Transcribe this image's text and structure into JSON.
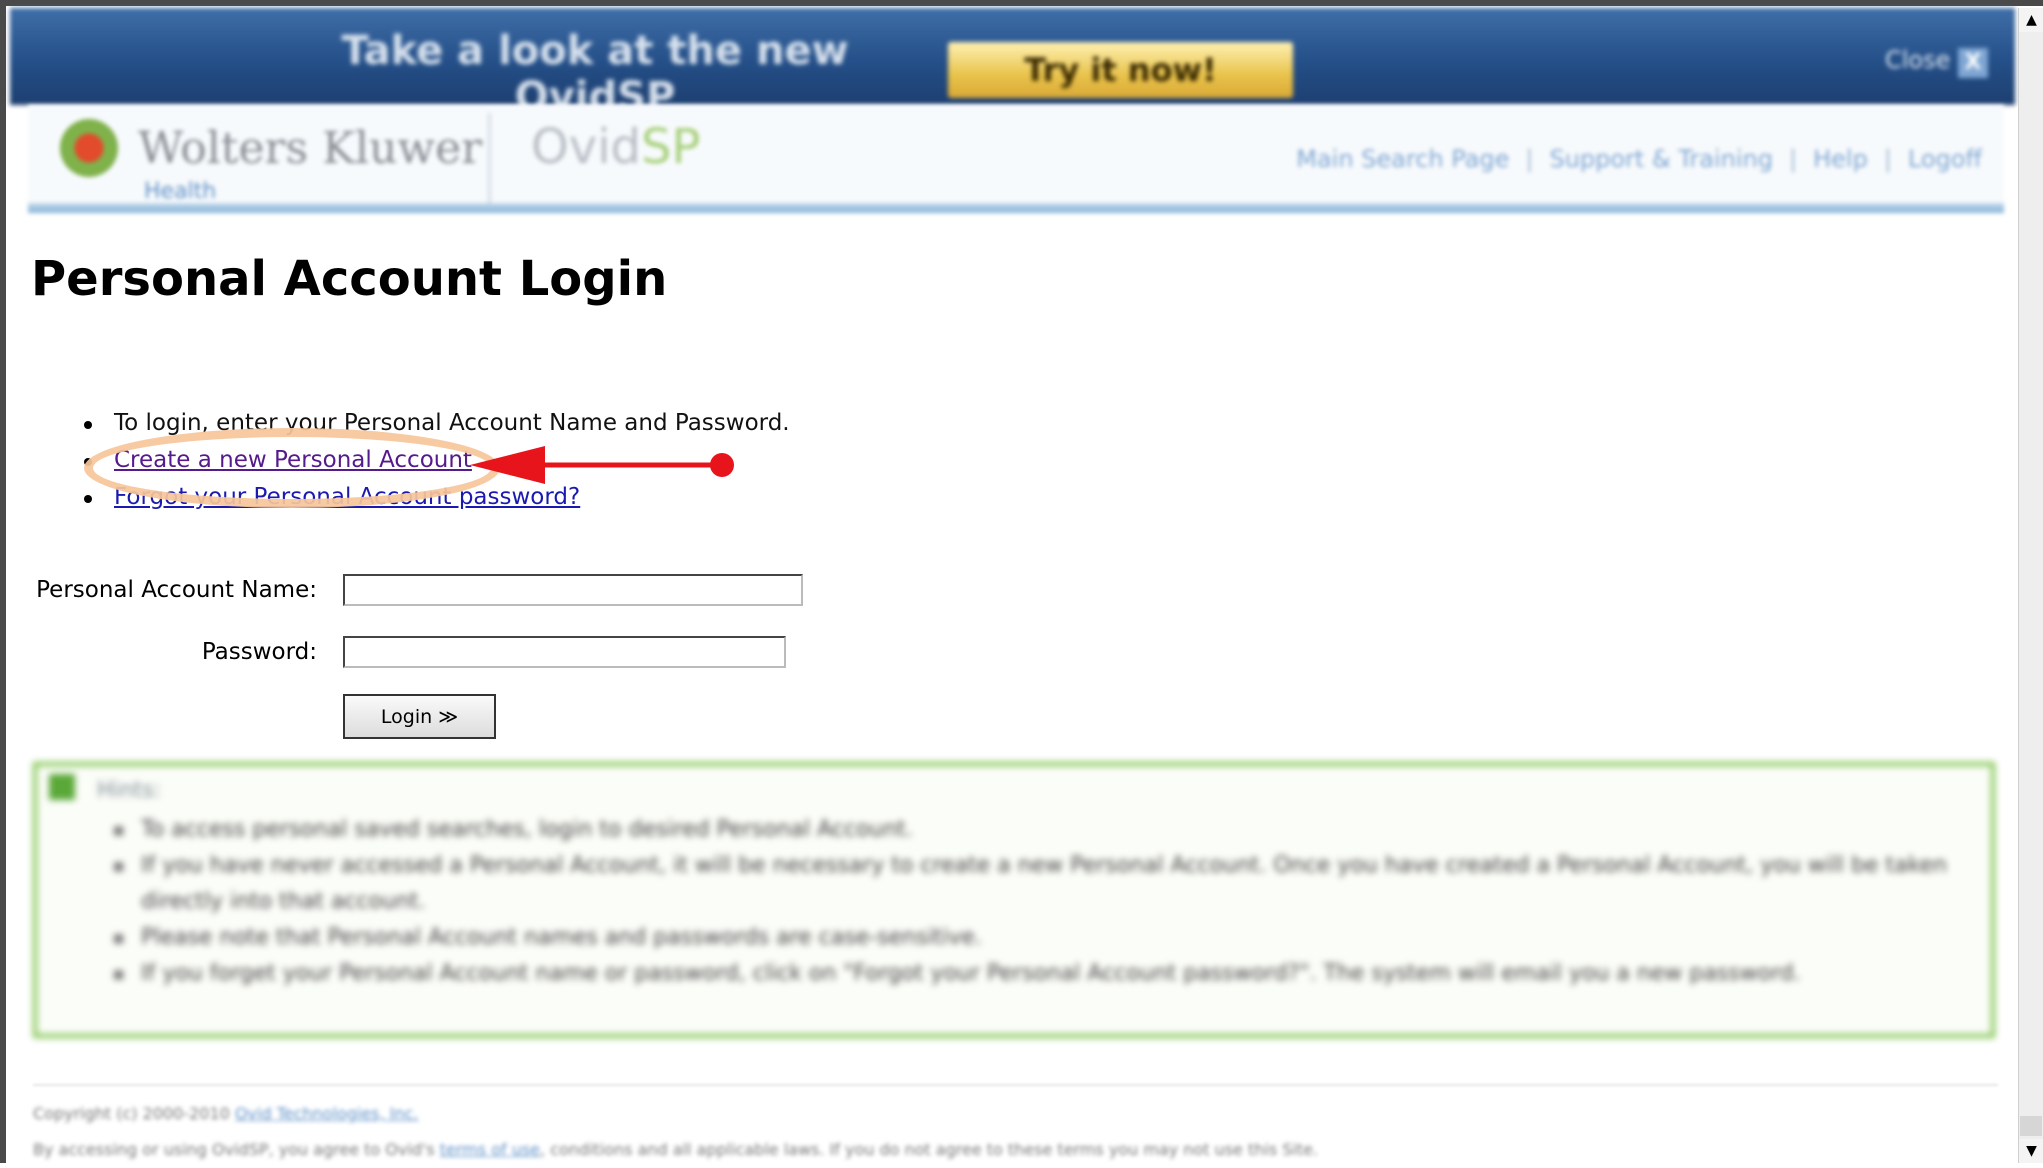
{
  "banner": {
    "text": "Take a look at the new OvidSP",
    "cta_label": "Try it now!",
    "close_label": "Close",
    "close_icon": "X"
  },
  "header": {
    "logo_name": "Wolters Kluwer",
    "logo_sub": "Health",
    "product_logo_a": "Ovid",
    "product_logo_b": "SP",
    "nav": [
      "Main Search Page",
      "Support & Training",
      "Help",
      "Logoff"
    ]
  },
  "page": {
    "title": "Personal Account Login"
  },
  "info": {
    "bullet_1": "To login, enter your Personal Account Name and Password.",
    "create_link": "Create a new Personal Account",
    "forgot_link": "Forgot your Personal Account password?"
  },
  "form": {
    "name_label": "Personal Account Name:",
    "name_value": "",
    "password_label": "Password:",
    "password_value": "",
    "login_label": "Login ≫"
  },
  "hints": {
    "title": "Hints:",
    "items": [
      "To access personal saved searches, login to desired Personal Account.",
      "If you have never accessed a Personal Account, it will be necessary to create a new Personal Account. Once you have created a Personal Account, you will be taken directly into that account.",
      "Please note that Personal Account names and passwords are case-sensitive.",
      "If you forget your Personal Account name or password, click on \"Forgot your Personal Account password?\". The system will email you a new password."
    ]
  },
  "footer": {
    "copyright": "Copyright (c) 2000-2010",
    "company_link": "Ovid Technologies, Inc.",
    "terms_prefix": "By accessing or using OvidSP, you agree to Ovid's",
    "terms_link": "terms of use",
    "terms_suffix": ", conditions and all applicable laws. If you do not agree to these terms you may not use this Site."
  },
  "colors": {
    "banner_blue": "#244f88",
    "cta_gold": "#e8c24a",
    "link_blue": "#1a1ab0",
    "visited_purple": "#551a8b",
    "hint_green": "#7cc24a",
    "annotation_red": "#e8141c",
    "annotation_orange": "#f7c69a"
  },
  "icons": {
    "logo": "wolters-kluwer-logo-icon",
    "hints": "hint-square-icon",
    "scroll_up": "arrow-up-icon",
    "scroll_down": "arrow-down-icon"
  }
}
